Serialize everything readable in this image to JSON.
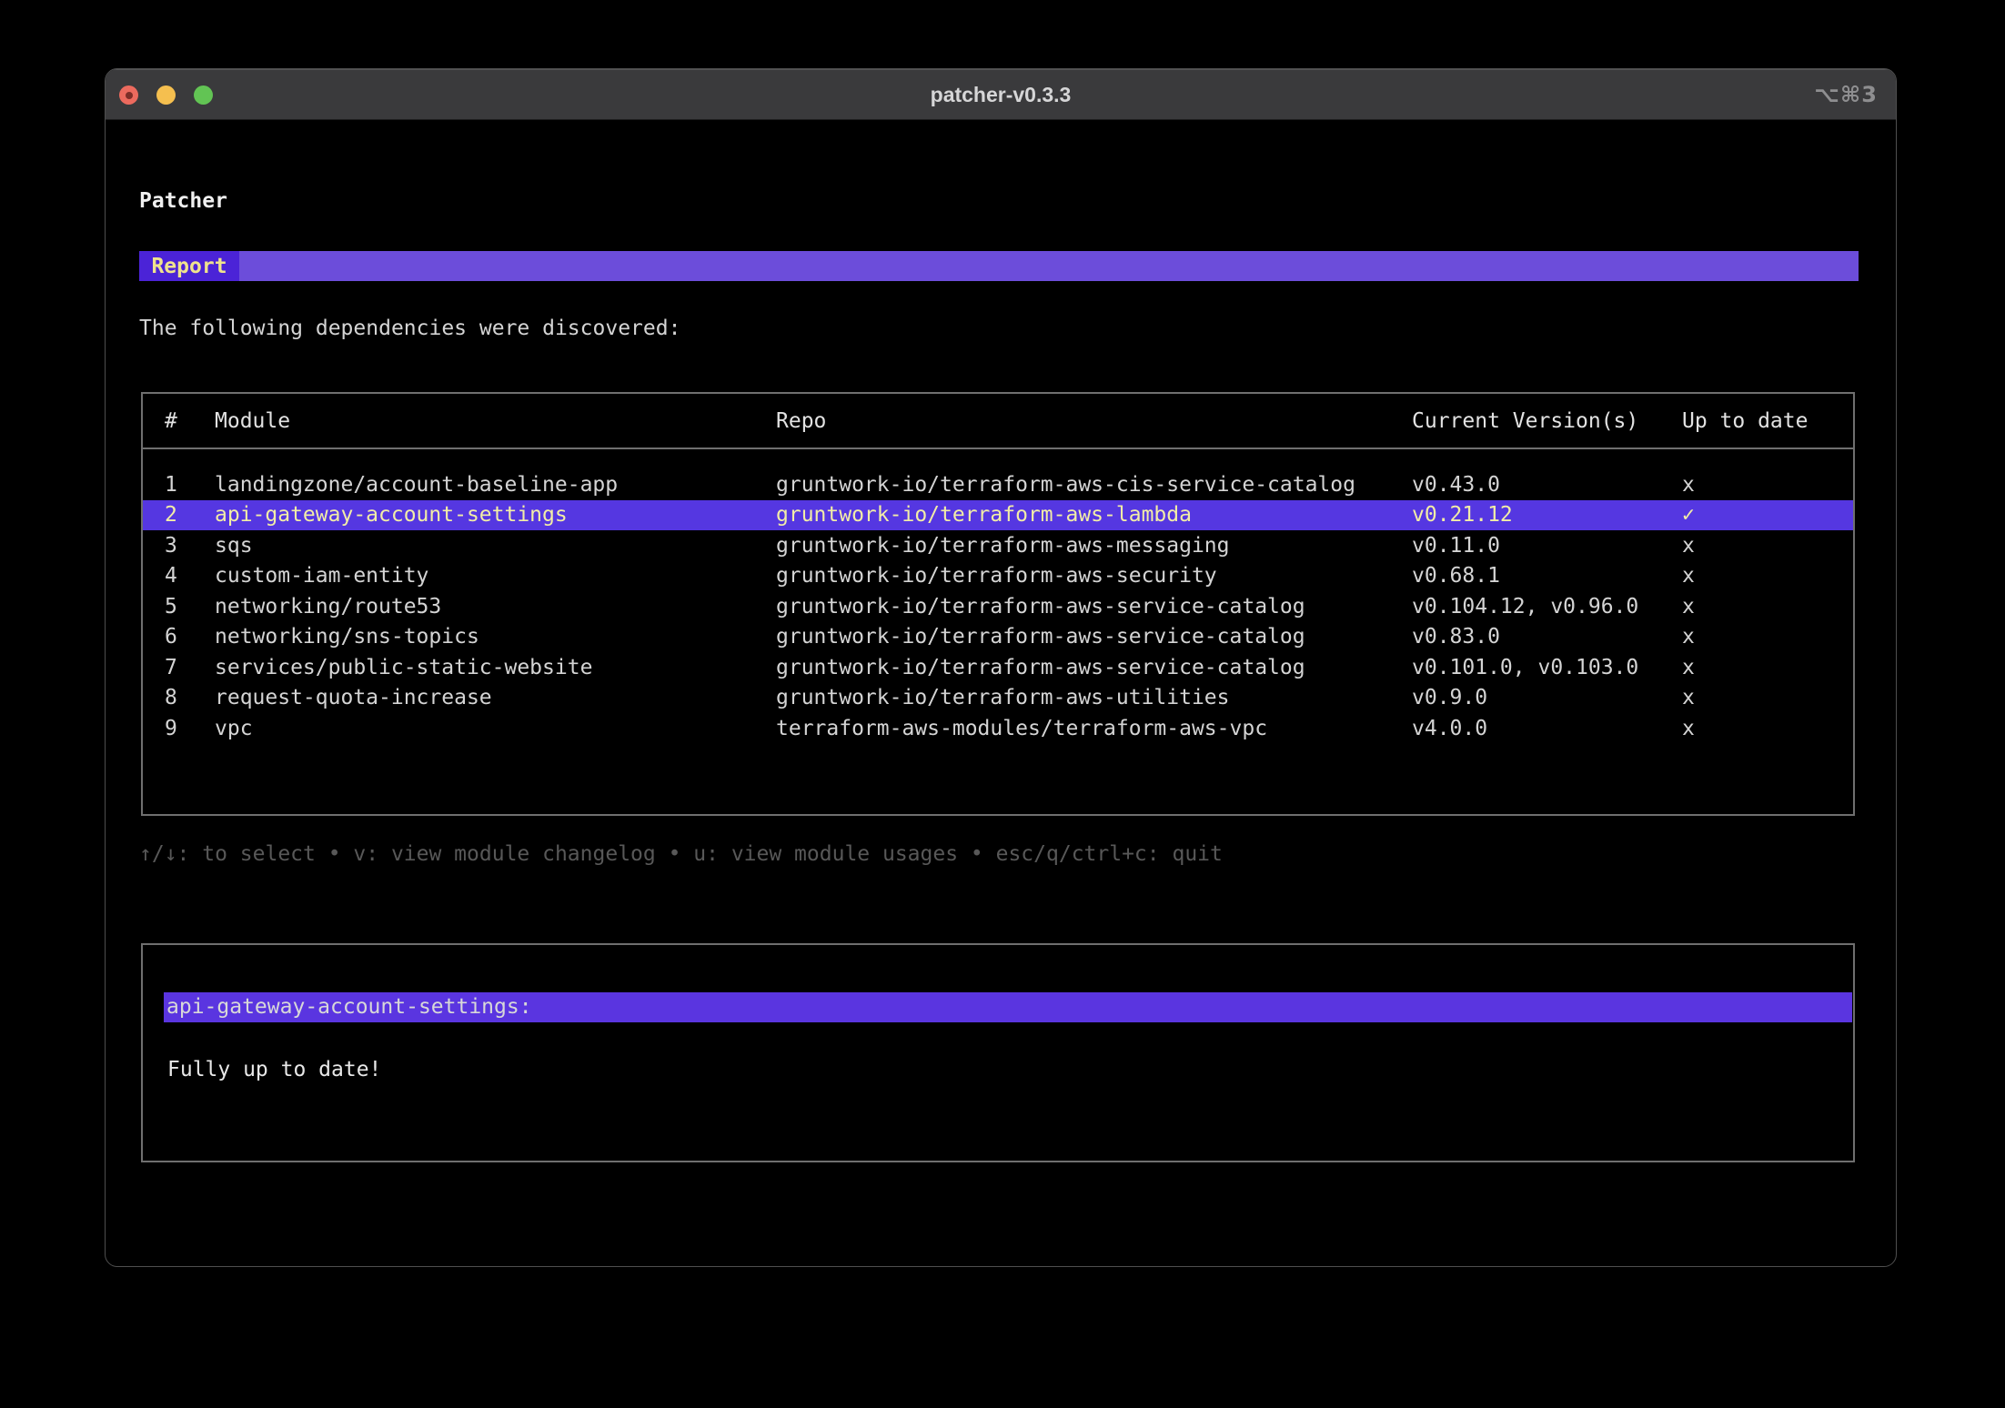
{
  "window": {
    "title": "patcher-v0.3.3",
    "shortcut": "⌥⌘3"
  },
  "app": {
    "heading": "Patcher",
    "tab_label": "Report",
    "intro": "The following dependencies were discovered:"
  },
  "table": {
    "headers": [
      "#",
      "Module",
      "Repo",
      "Current Version(s)",
      "Up to date"
    ],
    "rows": [
      {
        "num": "1",
        "module": "landingzone/account-baseline-app",
        "repo": "gruntwork-io/terraform-aws-cis-service-catalog",
        "versions": "v0.43.0",
        "up_to_date": "x",
        "selected": false
      },
      {
        "num": "2",
        "module": "api-gateway-account-settings",
        "repo": "gruntwork-io/terraform-aws-lambda",
        "versions": "v0.21.12",
        "up_to_date": "✓",
        "selected": true
      },
      {
        "num": "3",
        "module": "sqs",
        "repo": "gruntwork-io/terraform-aws-messaging",
        "versions": "v0.11.0",
        "up_to_date": "x",
        "selected": false
      },
      {
        "num": "4",
        "module": "custom-iam-entity",
        "repo": "gruntwork-io/terraform-aws-security",
        "versions": "v0.68.1",
        "up_to_date": "x",
        "selected": false
      },
      {
        "num": "5",
        "module": "networking/route53",
        "repo": "gruntwork-io/terraform-aws-service-catalog",
        "versions": "v0.104.12, v0.96.0",
        "up_to_date": "x",
        "selected": false
      },
      {
        "num": "6",
        "module": "networking/sns-topics",
        "repo": "gruntwork-io/terraform-aws-service-catalog",
        "versions": "v0.83.0",
        "up_to_date": "x",
        "selected": false
      },
      {
        "num": "7",
        "module": "services/public-static-website",
        "repo": "gruntwork-io/terraform-aws-service-catalog",
        "versions": "v0.101.0, v0.103.0",
        "up_to_date": "x",
        "selected": false
      },
      {
        "num": "8",
        "module": "request-quota-increase",
        "repo": "gruntwork-io/terraform-aws-utilities",
        "versions": "v0.9.0",
        "up_to_date": "x",
        "selected": false
      },
      {
        "num": "9",
        "module": "vpc",
        "repo": "terraform-aws-modules/terraform-aws-vpc",
        "versions": "v4.0.0",
        "up_to_date": "x",
        "selected": false
      }
    ]
  },
  "help": {
    "text": "↑/↓: to select • v: view module changelog • u: view module usages • esc/q/ctrl+c: quit"
  },
  "detail": {
    "title": "api-gateway-account-settings:",
    "status": "Fully up to date!"
  },
  "colors": {
    "terminal_bg": "#000000",
    "titlebar_bg": "#3a3a3c",
    "window_border": "#4f4f4f",
    "traffic_red": "#ec6a5e",
    "traffic_red_dot": "#7d2e28",
    "traffic_yellow": "#f5bf4f",
    "traffic_green": "#62c454",
    "tab_bg": "#4b23d7",
    "tabbar_bg": "#6c4dda",
    "tab_text": "#efe38d",
    "highlight_bg": "#5537e1",
    "highlight_text": "#f2eda7",
    "detail_bar_bg": "#5a35e0",
    "text": "#d4d4d4",
    "text_dim": "#585858",
    "border": "#6f6f6f"
  }
}
